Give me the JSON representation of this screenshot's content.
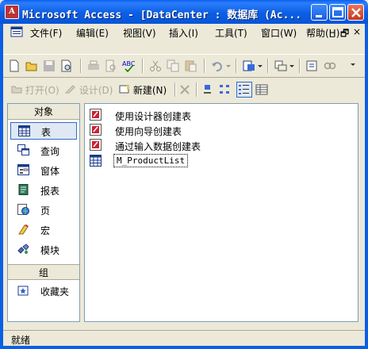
{
  "window": {
    "title": "Microsoft Access - [DataCenter : 数据库 (Ac...",
    "app_icon": "access-icon",
    "controls": [
      "minimize",
      "maximize",
      "close"
    ]
  },
  "menubar": {
    "items": [
      "文件(F)",
      "编辑(E)",
      "视图(V)",
      "插入(I)",
      "工具(T)",
      "窗口(W)",
      "帮助(H)"
    ],
    "mdi_controls": [
      "_",
      "🗗",
      "×"
    ]
  },
  "database_toolbar": {
    "open_label": "打开(O)",
    "design_label": "设计(D)",
    "new_label": "新建(N)"
  },
  "objects_bar": {
    "objects_header": "对象",
    "groups_header": "组",
    "items": [
      {
        "label": "表",
        "icon": "table-icon",
        "selected": true
      },
      {
        "label": "查询",
        "icon": "query-icon",
        "selected": false
      },
      {
        "label": "窗体",
        "icon": "form-icon",
        "selected": false
      },
      {
        "label": "报表",
        "icon": "report-icon",
        "selected": false
      },
      {
        "label": "页",
        "icon": "page-icon",
        "selected": false
      },
      {
        "label": "宏",
        "icon": "macro-icon",
        "selected": false
      },
      {
        "label": "模块",
        "icon": "module-icon",
        "selected": false
      }
    ],
    "group_items": [
      {
        "label": "收藏夹",
        "icon": "favorites-icon"
      }
    ]
  },
  "object_list": {
    "items": [
      {
        "label": "使用设计器创建表",
        "icon": "wizard-icon"
      },
      {
        "label": "使用向导创建表",
        "icon": "wizard-icon"
      },
      {
        "label": "通过输入数据创建表",
        "icon": "wizard-icon"
      },
      {
        "label": "M_ProductList",
        "icon": "table-icon"
      }
    ]
  },
  "status": {
    "text": "就绪"
  },
  "colors": {
    "titlebar": "#0b5fe5",
    "selection": "#316ac5",
    "face": "#ece9d8"
  }
}
